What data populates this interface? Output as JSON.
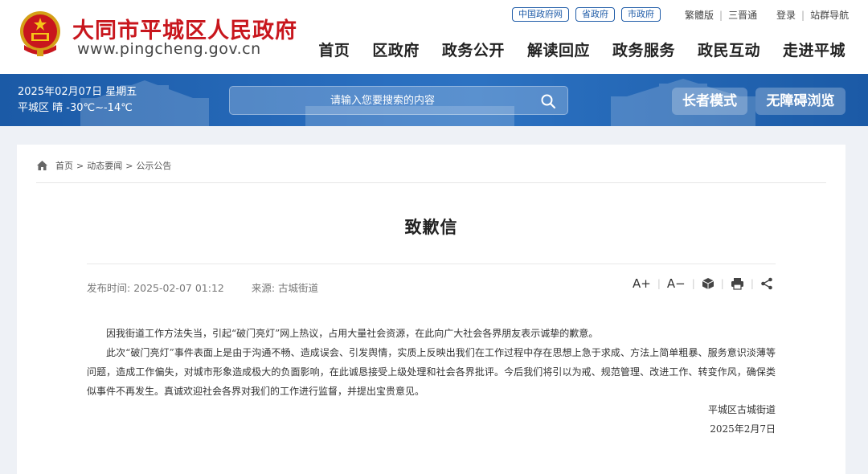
{
  "header": {
    "site_title": "大同市平城区人民政府",
    "site_domain": "www.pingcheng.gov.cn",
    "quick_links": [
      "中国政府网",
      "省政府",
      "市政府"
    ],
    "lang_links": [
      "繁體版",
      "三晋通"
    ],
    "user_links": [
      "登录",
      "站群导航"
    ],
    "nav": [
      "首页",
      "区政府",
      "政务公开",
      "解读回应",
      "政务服务",
      "政民互动",
      "走进平城"
    ]
  },
  "banner": {
    "date": "2025年02月07日 星期五",
    "weather": "平城区 晴 -30℃~-14℃",
    "search_placeholder": "请输入您要搜索的内容",
    "elder_mode": "长者模式",
    "accessible": "无障碍浏览"
  },
  "breadcrumb": [
    "首页",
    "动态要闻",
    "公示公告"
  ],
  "article": {
    "title": "致歉信",
    "publish_label": "发布时间:",
    "publish_time": "2025-02-07 01:12",
    "source_label": "来源:",
    "source": "古城街道",
    "font_larger": "A+",
    "font_smaller": "A−",
    "paragraphs": [
      "因我街道工作方法失当，引起“破门亮灯”网上热议，占用大量社会资源，在此向广大社会各界朋友表示诚挚的歉意。",
      "此次“破门亮灯”事件表面上是由于沟通不畅、造成误会、引发舆情，实质上反映出我们在工作过程中存在思想上急于求成、方法上简单粗暴、服务意识淡薄等问题，造成工作偏失，对城市形象造成极大的负面影响，在此诚恳接受上级处理和社会各界批评。今后我们将引以为戒、规范管理、改进工作、转变作风，确保类似事件不再发生。真诚欢迎社会各界对我们的工作进行监督，并提出宝贵意见。"
    ],
    "signature_org": "平城区古城街道",
    "signature_date": "2025年2月7日"
  },
  "colors": {
    "brand_red": "#c8161d",
    "banner_blue": "#1b5aa6",
    "link_blue": "#1f5ca8"
  },
  "icons": [
    "national-emblem-icon",
    "search-icon",
    "home-icon",
    "3d-cube-icon",
    "print-icon",
    "share-icon"
  ]
}
